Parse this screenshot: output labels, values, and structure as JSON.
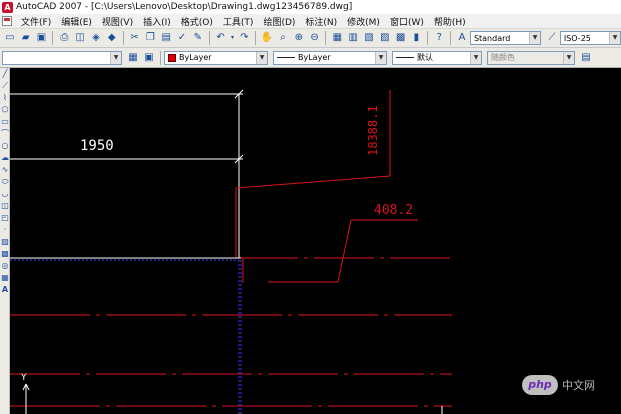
{
  "titlebar": {
    "title": "AutoCAD 2007 - [C:\\Users\\Lenovo\\Desktop\\Drawing1.dwg123456789.dwg]",
    "app_icon": "A"
  },
  "menubar": {
    "items": [
      "文件(F)",
      "编辑(E)",
      "视图(V)",
      "插入(I)",
      "格式(O)",
      "工具(T)",
      "绘图(D)",
      "标注(N)",
      "修改(M)",
      "窗口(W)",
      "帮助(H)"
    ]
  },
  "toolbar1": {
    "icons": [
      "new-icon",
      "open-icon",
      "save-icon",
      "print-icon",
      "preview-icon",
      "publish-icon",
      "plot-icon",
      "cut-icon",
      "copy-icon",
      "paste-icon",
      "match-icon",
      "brush-icon",
      "undo-icon",
      "redo-icon",
      "pan-icon",
      "zoom-realtime-icon",
      "zoom-window-icon",
      "zoom-previous-icon",
      "properties-icon",
      "design-center-icon",
      "tool-palettes-icon",
      "sheet-set-icon",
      "markup-icon",
      "calculator-icon",
      "help-icon"
    ],
    "text_style": "Standard",
    "dim_style": "ISO-25"
  },
  "toolbar2": {
    "layer": "",
    "color": "ByLayer",
    "color_hex": "#e00000",
    "linetype": "ByLayer",
    "lineweight": "默认",
    "plotstyle": "随颜色"
  },
  "lefttools": [
    "line-icon",
    "construction-line-icon",
    "polyline-icon",
    "polygon-icon",
    "rectangle-icon",
    "arc-icon",
    "circle-icon",
    "revision-cloud-icon",
    "spline-icon",
    "ellipse-icon",
    "ellipse-arc-icon",
    "insert-block-icon",
    "make-block-icon",
    "point-icon",
    "hatch-icon",
    "gradient-icon",
    "region-icon",
    "table-icon",
    "multiline-text-icon"
  ],
  "drawing": {
    "dim_horizontal": "1950",
    "dim_vertical": "18388.1",
    "dim_leader": "408.2",
    "ucs_axis": "Y",
    "colors": {
      "white": "#ffffff",
      "red": "#d8131a",
      "blue": "#3a3aff"
    }
  },
  "watermark": {
    "logo": "php",
    "text": "中文网"
  }
}
